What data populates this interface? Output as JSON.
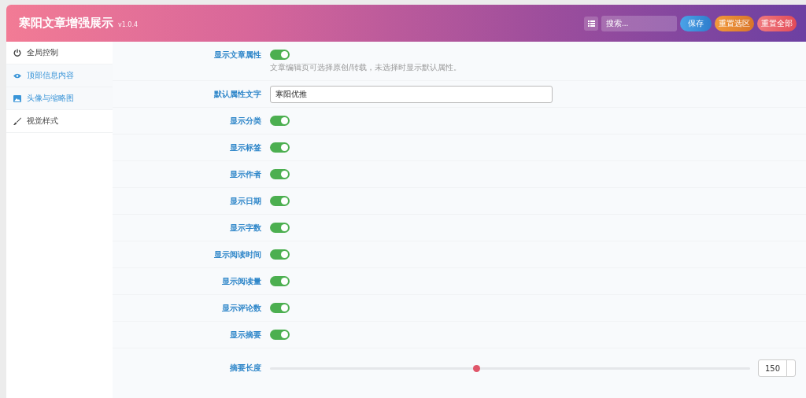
{
  "header": {
    "title": "寒阳文章增强展示",
    "version": "v1.0.4",
    "search": {
      "placeholder": "搜索..."
    },
    "buttons": [
      {
        "label": "保存",
        "kind": "save"
      },
      {
        "label": "重置选区",
        "kind": "reset-section"
      },
      {
        "label": "重置全部",
        "kind": "reset-all"
      }
    ]
  },
  "sidebar": {
    "items": [
      {
        "label": "全局控制",
        "selected": false
      },
      {
        "label": "顶部信息内容",
        "selected": true
      },
      {
        "label": "头像与缩略图",
        "selected": true
      },
      {
        "label": "视觉样式",
        "selected": false
      }
    ]
  },
  "settings": [
    {
      "kind": "toggle",
      "label": "显示文章属性",
      "on": true,
      "description": "文章编辑页可选择原创/转载，未选择时显示默认属性。"
    },
    {
      "kind": "text",
      "label": "默认属性文字",
      "value": "寒阳优推"
    },
    {
      "kind": "toggle",
      "label": "显示分类",
      "on": true
    },
    {
      "kind": "toggle",
      "label": "显示标签",
      "on": true
    },
    {
      "kind": "toggle",
      "label": "显示作者",
      "on": true
    },
    {
      "kind": "toggle",
      "label": "显示日期",
      "on": true
    },
    {
      "kind": "toggle",
      "label": "显示字数",
      "on": true
    },
    {
      "kind": "toggle",
      "label": "显示阅读时间",
      "on": true
    },
    {
      "kind": "toggle",
      "label": "显示阅读量",
      "on": true
    },
    {
      "kind": "toggle",
      "label": "显示评论数",
      "on": true
    },
    {
      "kind": "toggle",
      "label": "显示摘要",
      "on": true
    },
    {
      "kind": "slider",
      "label": "摘要长度",
      "level": 0.43,
      "value": "150"
    }
  ]
}
